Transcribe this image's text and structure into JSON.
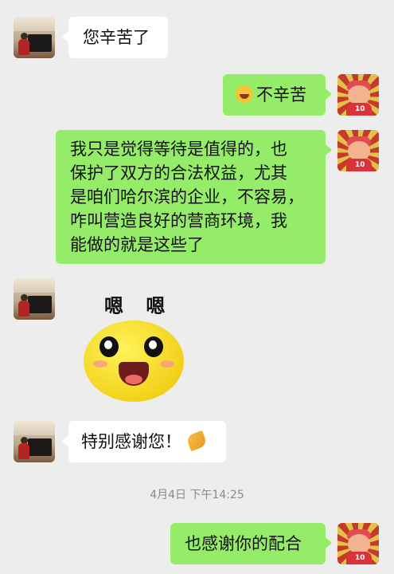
{
  "messages": [
    {
      "side": "left",
      "text": "您辛苦了"
    },
    {
      "side": "right",
      "emoji": "laughing-tears",
      "text": "不辛苦"
    },
    {
      "side": "right",
      "lines": [
        "我只是觉得等待是值得的，也",
        "保护了双方的合法权益，尤其",
        "是咱们哈尔滨的企业，不容易，",
        "咋叫营造良好的营商环境，我",
        "能做的就是这些了"
      ]
    },
    {
      "side": "left",
      "sticker": {
        "text": "嗯 嗯",
        "icon": "yellow-smiley-sticker"
      }
    },
    {
      "side": "left",
      "text": "特别感谢您！",
      "emoji": "clapping-hands"
    },
    {
      "side": "right",
      "text": "也感谢你的配合"
    }
  ],
  "timestamp": "4月4日 下午14:25",
  "avatars": {
    "left": "piano-photo-avatar",
    "right": "cartoon-player-avatar"
  },
  "avatar_jersey_number": "10",
  "colors": {
    "background": "#ededed",
    "bubble_left": "#ffffff",
    "bubble_right": "#95ec69"
  }
}
